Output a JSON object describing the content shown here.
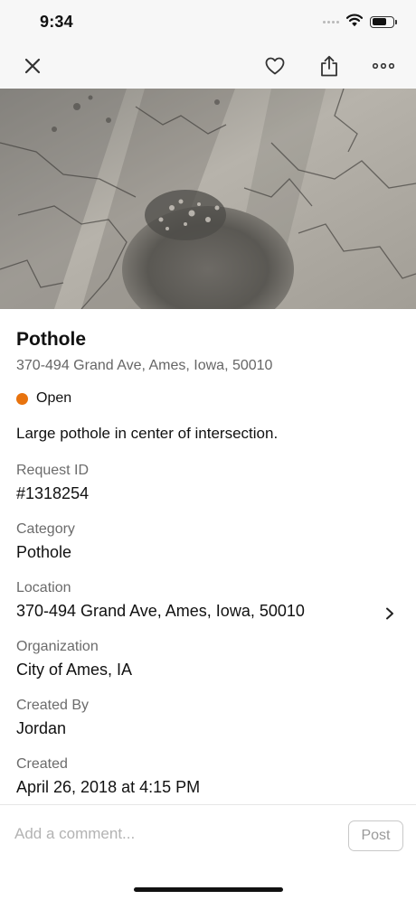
{
  "status_bar": {
    "time": "9:34",
    "icons": [
      "signal-dots-icon",
      "wifi-icon",
      "battery-icon"
    ]
  },
  "nav": {
    "icons": [
      "close-icon",
      "heart-icon",
      "share-icon",
      "more-icon"
    ]
  },
  "report": {
    "title": "Pothole",
    "address": "370-494 Grand Ave, Ames, Iowa, 50010",
    "status": "Open",
    "status_color": "#e8730e",
    "description": "Large pothole in center of intersection."
  },
  "fields": [
    {
      "label": "Request ID",
      "value": "#1318254"
    },
    {
      "label": "Category",
      "value": "Pothole"
    },
    {
      "label": "Location",
      "value": "370-494 Grand Ave, Ames, Iowa, 50010"
    },
    {
      "label": "Organization",
      "value": "City of Ames, IA"
    },
    {
      "label": "Created By",
      "value": "Jordan"
    },
    {
      "label": "Created",
      "value": "April 26, 2018 at 4:15 PM"
    }
  ],
  "comment": {
    "placeholder": "Add a comment...",
    "post_label": "Post"
  }
}
